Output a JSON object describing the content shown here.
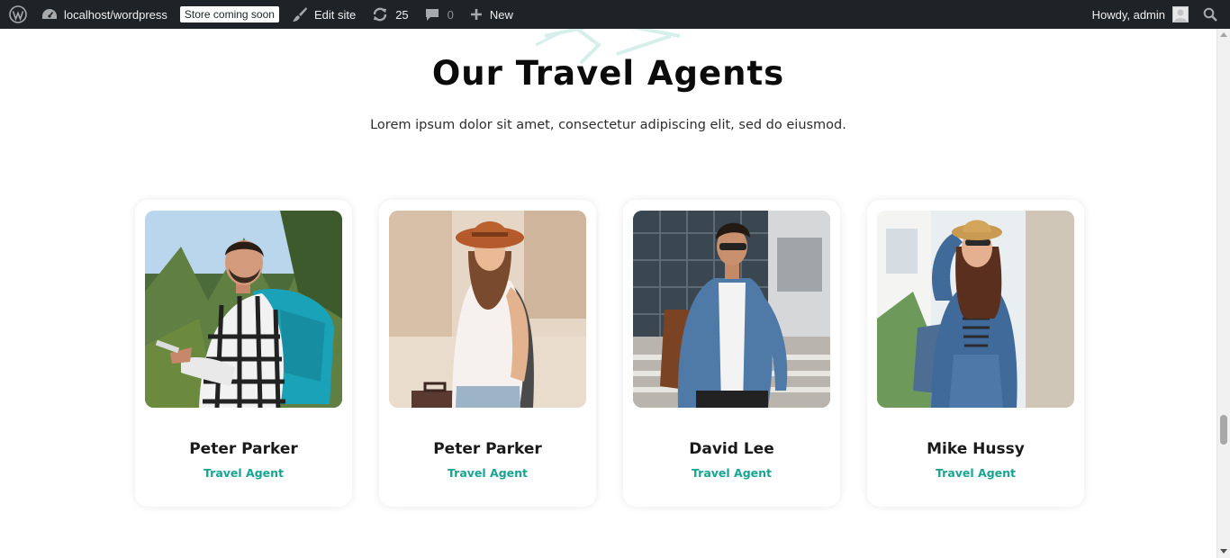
{
  "adminbar": {
    "site_name": "localhost/wordpress",
    "badge": "Store coming soon",
    "edit_site": "Edit site",
    "updates_count": "25",
    "comments_count": "0",
    "new_label": "New",
    "howdy": "Howdy, admin"
  },
  "section": {
    "title": "Our Travel Agents",
    "subtitle": "Lorem ipsum dolor sit amet, consectetur adipiscing elit, sed do eiusmod."
  },
  "agents": [
    {
      "name": "Peter Parker",
      "role": "Travel Agent"
    },
    {
      "name": "Peter Parker",
      "role": "Travel Agent"
    },
    {
      "name": "David Lee",
      "role": "Travel Agent"
    },
    {
      "name": "Mike Hussy",
      "role": "Travel Agent"
    }
  ],
  "colors": {
    "adminbar_bg": "#1d2327",
    "accent": "#17a592",
    "title": "#0b0b0b"
  }
}
